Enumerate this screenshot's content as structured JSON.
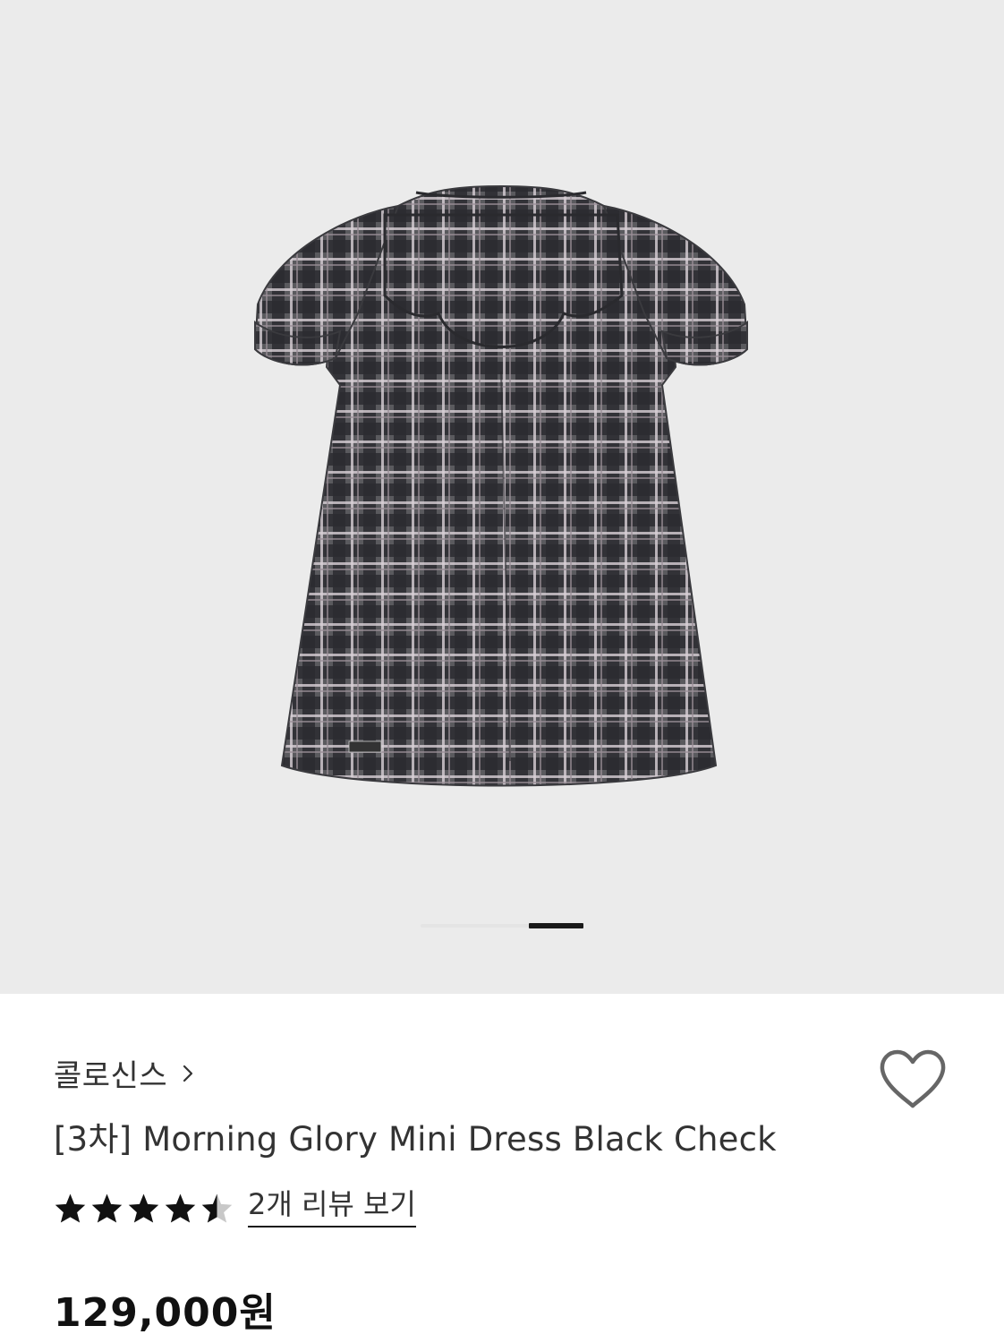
{
  "gallery": {
    "image_alt": "Morning Glory Mini Dress Black Check product photo",
    "slide_index": 2,
    "slide_count": 3,
    "background_color": "#ebebeb"
  },
  "product": {
    "brand": "콜로신스",
    "title": "[3차] Morning Glory Mini Dress Black Check",
    "rating": 4.5,
    "rating_max": 5,
    "review_link": "2개 리뷰 보기",
    "price": "129,000원",
    "wishlisted": false
  },
  "icons": {
    "brand_chevron": "chevron-right-icon",
    "wishlist": "heart-outline-icon",
    "star": "star-icon"
  },
  "colors": {
    "text_primary": "#1a1a1a",
    "text_secondary": "#333333",
    "star_filled": "#111111",
    "star_empty": "#c8c8c8"
  }
}
